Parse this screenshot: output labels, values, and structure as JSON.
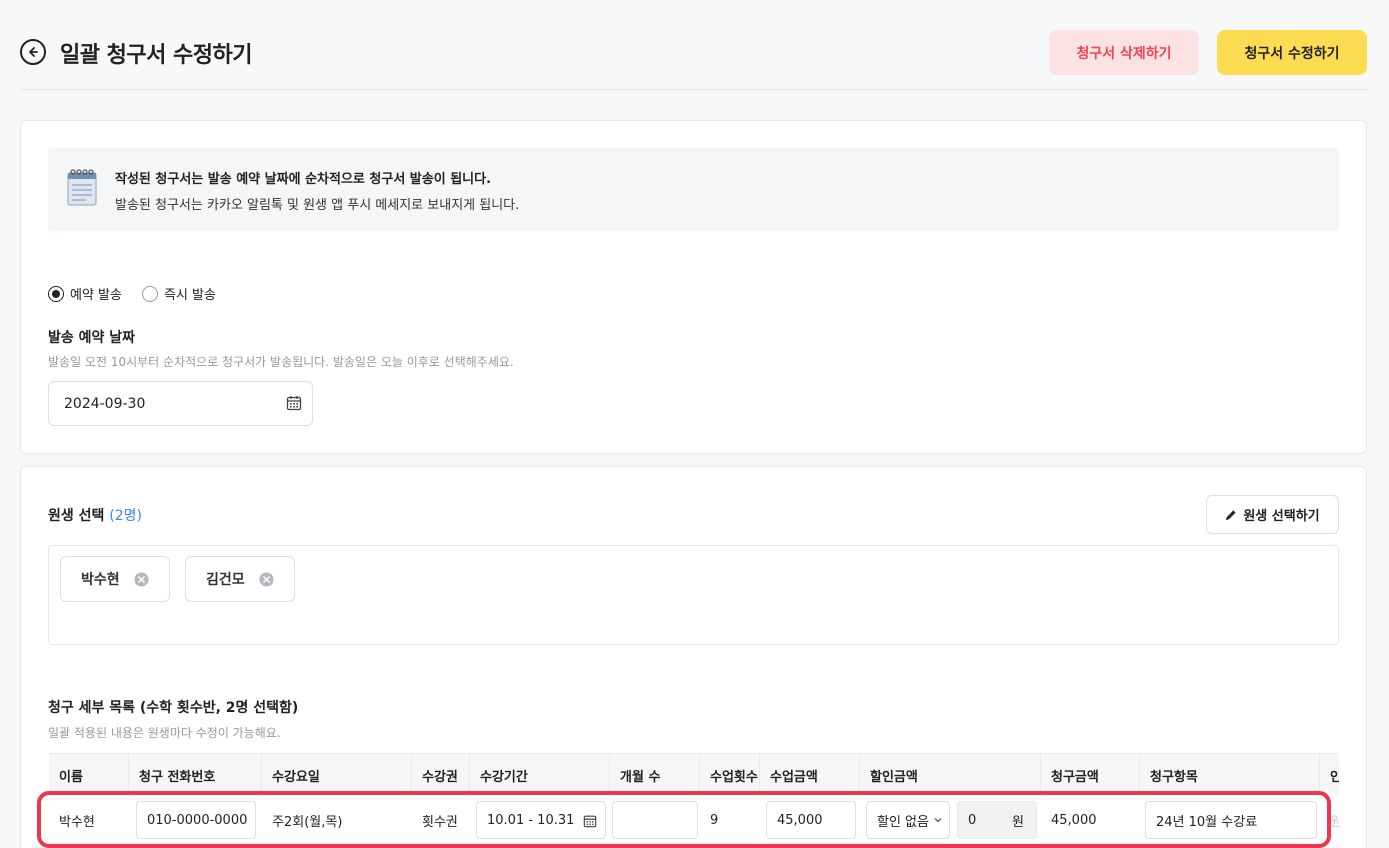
{
  "header": {
    "title": "일괄 청구서 수정하기",
    "delete_label": "청구서 삭제하기",
    "edit_label": "청구서 수정하기"
  },
  "notice": {
    "line1": "작성된 청구서는 발송 예약 날짜에 순차적으로 청구서 발송이 됩니다.",
    "line2": "발송된 청구서는 카카오 알림톡 및 원생 앱 푸시 메세지로 보내지게 됩니다."
  },
  "send_mode": {
    "options": [
      {
        "label": "예약 발송",
        "selected": true
      },
      {
        "label": "즉시 발송",
        "selected": false
      }
    ]
  },
  "schedule": {
    "label": "발송 예약 날짜",
    "help": "발송일 오전 10시부터 순차적으로 청구서가 발송됩니다. 발송일은 오늘 이후로 선택해주세요.",
    "date": "2024-09-30"
  },
  "students": {
    "title": "원생 선택",
    "count": "(2명)",
    "select_label": "원생 선택하기",
    "chips": [
      "박수현",
      "김건모"
    ]
  },
  "details": {
    "title": "청구 세부 목록 (수학 횟수반, 2명 선택함)",
    "help": "일괄 적용된 내용은 원생마다 수정이 가능해요.",
    "columns": [
      "이름",
      "청구 전화번호",
      "수강요일",
      "수강권",
      "수강기간",
      "개월 수",
      "수업횟수",
      "수업금액",
      "할인금액",
      "청구금액",
      "청구항목",
      "인"
    ],
    "row": {
      "name": "박수현",
      "phone": "010-0000-0000",
      "days": "주2회(월,목)",
      "ticket": "횟수권",
      "period": "10.01 - 10.31",
      "months": "",
      "sessions": "9",
      "lesson_amount": "45,000",
      "discount_type": "할인 없음",
      "discount_value": "0",
      "discount_unit": "원",
      "bill_amount": "45,000",
      "bill_item": "24년 10월 수강료",
      "overflow": "원"
    }
  },
  "colors": {
    "accent_yellow": "#fddc51",
    "delete_bg": "#fde2e4",
    "delete_text": "#f04452",
    "count_blue": "#3b82f6",
    "highlight_red": "#f0364f"
  }
}
